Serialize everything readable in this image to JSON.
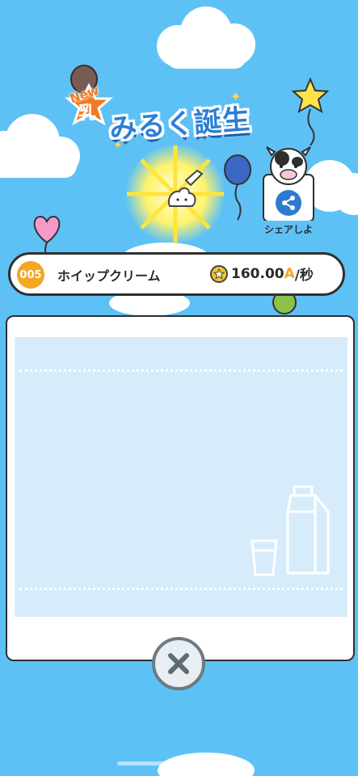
{
  "title": {
    "new_badge": "New",
    "kanji_badge": "乳",
    "text": "みるく誕生"
  },
  "share": {
    "label": "シェアしよ",
    "icon": "share-icon"
  },
  "item": {
    "level": "005",
    "name": "ホイップクリーム"
  },
  "rate": {
    "value": "160.00",
    "unit": "A",
    "per": "/秒",
    "icon": "star-coin-icon"
  },
  "panel": {
    "illustration": "milk-carton-and-glass"
  },
  "close": {
    "icon": "close-icon"
  },
  "colors": {
    "sky": "#5ec1f5",
    "badge": "#f5a623",
    "title_blue": "#2b7fd6",
    "panel_bg": "#d6ecfb"
  }
}
